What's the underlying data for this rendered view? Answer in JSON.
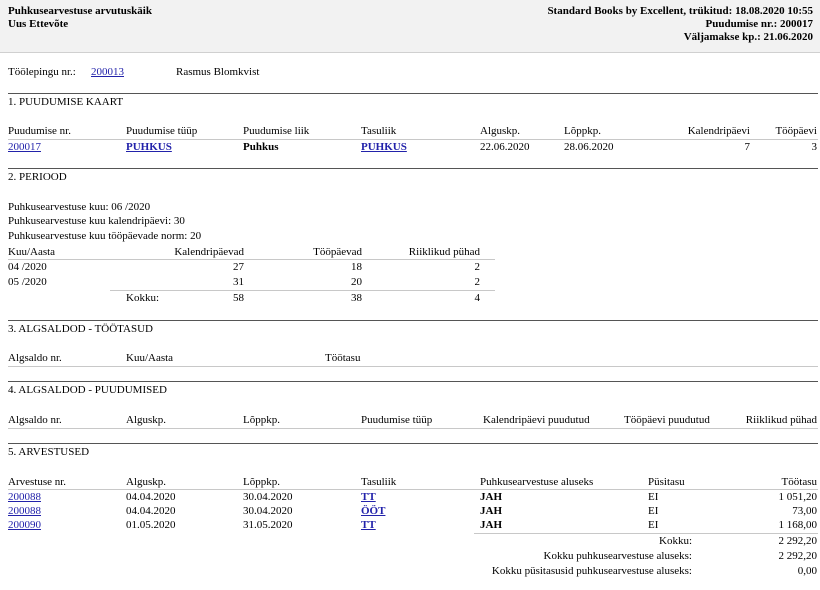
{
  "header": {
    "title": "Puhkusearvestuse arvutuskäik",
    "company": "Uus Ettevõte",
    "printed": "Standard Books by Excellent, trükitud: 18.08.2020 10:55",
    "absence_no": "Puudumise nr.: 200017",
    "payment_date": "Väljamakse kp.: 21.06.2020"
  },
  "contract": {
    "label": "Töölepingu nr.:",
    "number": "200013",
    "employee": "Rasmus Blomkvist"
  },
  "s1": {
    "title": "1. PUUDUMISE KAART",
    "headers": [
      "Puudumise nr.",
      "Puudumise tüüp",
      "Puudumise liik",
      "Tasuliik",
      "Alguskp.",
      "Lõppkp.",
      "Kalendripäevi",
      "Tööpäevi"
    ],
    "row": [
      "200017",
      "PUHKUS",
      "Puhkus",
      "PUHKUS",
      "22.06.2020",
      "28.06.2020",
      "7",
      "3"
    ]
  },
  "s2": {
    "title": "2. PERIOOD",
    "month": "Puhkusearvestuse kuu:  06 /2020",
    "caldays": "Puhkusearvestuse kuu kalendripäevi:  30",
    "norm": "Puhkusearvestuse kuu tööpäevade norm:  20",
    "headers": [
      "Kuu/Aasta",
      "Kalendripäevad",
      "Tööpäevad",
      "Riiklikud pühad"
    ],
    "rows": [
      [
        "04 /2020",
        "27",
        "18",
        "2"
      ],
      [
        "05 /2020",
        "31",
        "20",
        "2"
      ]
    ],
    "total": [
      "Kokku:",
      "58",
      "38",
      "4"
    ]
  },
  "s3": {
    "title": "3. ALGSALDOD - TÖÖTASUD",
    "headers": [
      "Algsaldo nr.",
      "Kuu/Aasta",
      "Töötasu"
    ]
  },
  "s4": {
    "title": "4. ALGSALDOD - PUUDUMISED",
    "headers": [
      "Algsaldo nr.",
      "Alguskp.",
      "Lõppkp.",
      "Puudumise tüüp",
      "Kalendripäevi puudutud",
      "Tööpäevi puudutud",
      "Riiklikud pühad"
    ]
  },
  "s5": {
    "title": "5. ARVESTUSED",
    "headers": [
      "Arvestuse nr.",
      "Alguskp.",
      "Lõppkp.",
      "Tasuliik",
      "Puhkusearvestuse aluseks",
      "Püsitasu",
      "Töötasu"
    ],
    "rows": [
      [
        "200088",
        "04.04.2020",
        "30.04.2020",
        "TT",
        "JAH",
        "EI",
        "1 051,20"
      ],
      [
        "200088",
        "04.04.2020",
        "30.04.2020",
        "ÖÖT",
        "JAH",
        "EI",
        "73,00"
      ],
      [
        "200090",
        "01.05.2020",
        "31.05.2020",
        "TT",
        "JAH",
        "EI",
        "1 168,00"
      ]
    ],
    "totals": [
      [
        "Kokku:",
        "2 292,20"
      ],
      [
        "Kokku puhkusearvestuse aluseks:",
        "2 292,20"
      ],
      [
        "Kokku püsitasusid puhkusearvestuse aluseks:",
        "0,00"
      ]
    ]
  }
}
